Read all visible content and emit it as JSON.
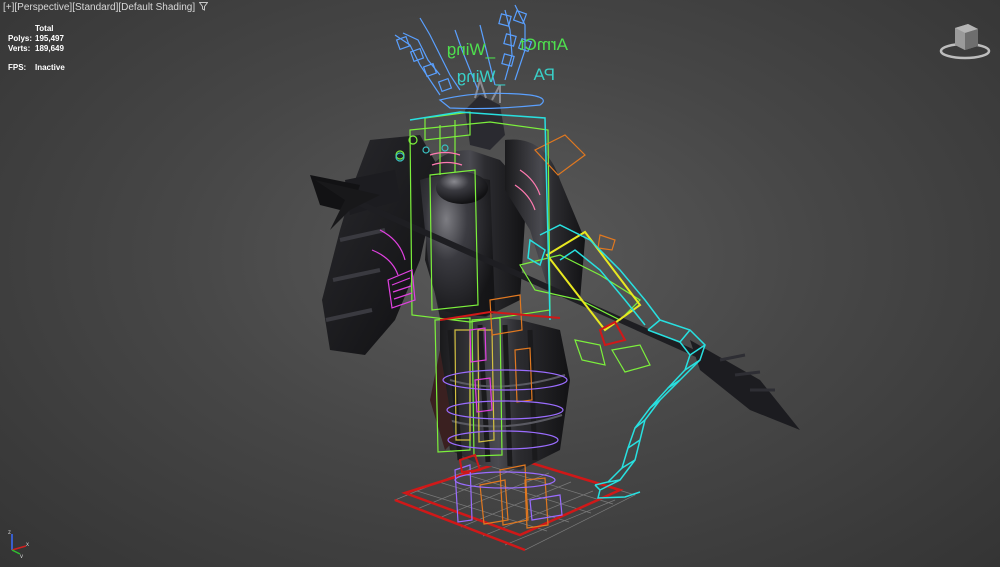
{
  "viewport": {
    "label_parts": [
      "[+]",
      "[Perspective]",
      "[Standard]",
      "[Default Shading]"
    ],
    "filter_icon": "funnel-icon"
  },
  "stats": {
    "header": "Total",
    "polys_label": "Polys:",
    "polys_value": "195,497",
    "verts_label": "Verts:",
    "verts_value": "189,649",
    "fps_label": "FPS:",
    "fps_value": "Inactive"
  },
  "scene": {
    "name_tag_1": "ArmCt",
    "name_tag_2": "_Wing",
    "name_tag_3": "PA",
    "name_tag_4": "_Wing"
  },
  "viewcube": {
    "icon": "viewcube-icon"
  },
  "axis_gizmo": {
    "icon": "axis-tripod-icon"
  },
  "colors": {
    "background": "#474747",
    "grid": "#7a7a7a",
    "grid_red": "#d01818",
    "bone_cyan": "#28e0e0",
    "bone_green": "#7cf03c",
    "bone_yellow": "#e8e820",
    "bone_magenta": "#e040e0",
    "bone_orange": "#e07820",
    "bone_blue": "#5aa0ff",
    "bone_purple": "#9a6cff"
  }
}
